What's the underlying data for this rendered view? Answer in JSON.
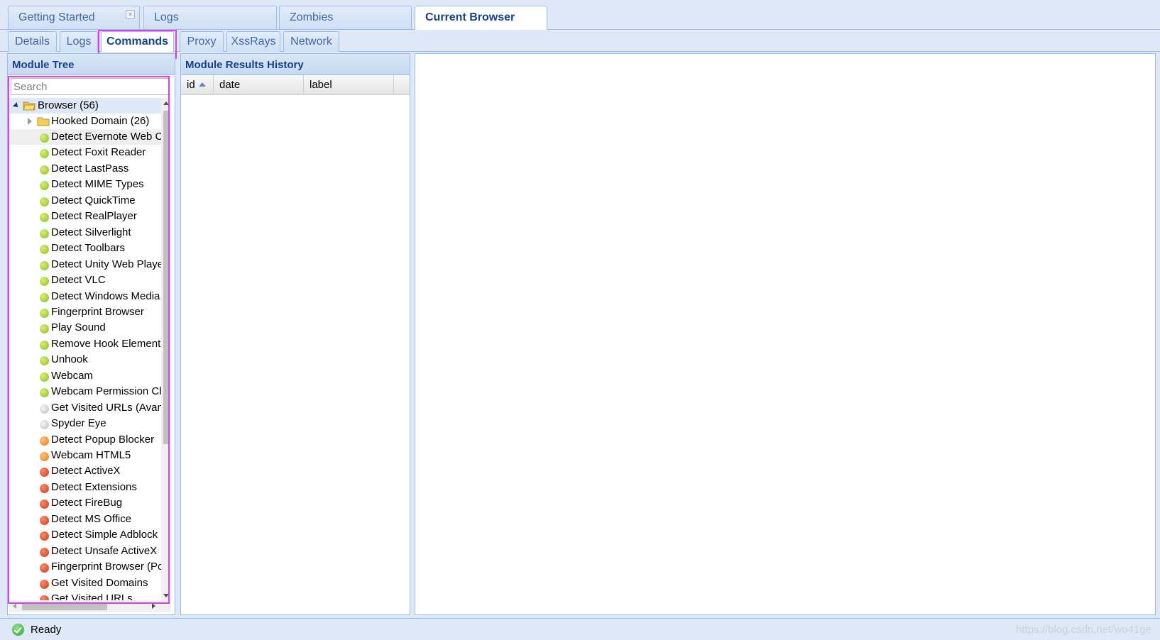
{
  "top_tabs": [
    {
      "label": "Getting Started",
      "closable": true,
      "active": false
    },
    {
      "label": "Logs",
      "active": false
    },
    {
      "label": "Zombies",
      "active": false
    },
    {
      "label": "Current Browser",
      "active": true
    }
  ],
  "sub_tabs": [
    {
      "label": "Details",
      "active": false
    },
    {
      "label": "Logs",
      "active": false
    },
    {
      "label": "Commands",
      "active": true
    },
    {
      "label": "Proxy",
      "active": false
    },
    {
      "label": "XssRays",
      "active": false
    },
    {
      "label": "Network",
      "active": false
    }
  ],
  "close_glyph": "×",
  "module_tree": {
    "title": "Module Tree",
    "search_placeholder": "Search",
    "root": "Browser (56)",
    "folder": "Hooked Domain (26)",
    "items": [
      {
        "label": "Detect Evernote Web Clipper",
        "status": "green"
      },
      {
        "label": "Detect Foxit Reader",
        "status": "green"
      },
      {
        "label": "Detect LastPass",
        "status": "green"
      },
      {
        "label": "Detect MIME Types",
        "status": "green"
      },
      {
        "label": "Detect QuickTime",
        "status": "green"
      },
      {
        "label": "Detect RealPlayer",
        "status": "green"
      },
      {
        "label": "Detect Silverlight",
        "status": "green"
      },
      {
        "label": "Detect Toolbars",
        "status": "green"
      },
      {
        "label": "Detect Unity Web Player",
        "status": "green"
      },
      {
        "label": "Detect VLC",
        "status": "green"
      },
      {
        "label": "Detect Windows Media Player",
        "status": "green"
      },
      {
        "label": "Fingerprint Browser",
        "status": "green"
      },
      {
        "label": "Play Sound",
        "status": "green"
      },
      {
        "label": "Remove Hook Element",
        "status": "green"
      },
      {
        "label": "Unhook",
        "status": "green"
      },
      {
        "label": "Webcam",
        "status": "green"
      },
      {
        "label": "Webcam Permission Check",
        "status": "green"
      },
      {
        "label": "Get Visited URLs (Avant Browser)",
        "status": "grey"
      },
      {
        "label": "Spyder Eye",
        "status": "grey"
      },
      {
        "label": "Detect Popup Blocker",
        "status": "orange"
      },
      {
        "label": "Webcam HTML5",
        "status": "orange"
      },
      {
        "label": "Detect ActiveX",
        "status": "red"
      },
      {
        "label": "Detect Extensions",
        "status": "red"
      },
      {
        "label": "Detect FireBug",
        "status": "red"
      },
      {
        "label": "Detect MS Office",
        "status": "red"
      },
      {
        "label": "Detect Simple Adblock",
        "status": "red"
      },
      {
        "label": "Detect Unsafe ActiveX",
        "status": "red"
      },
      {
        "label": "Fingerprint Browser (PoC)",
        "status": "red"
      },
      {
        "label": "Get Visited Domains",
        "status": "red"
      },
      {
        "label": "Get Visited URLs",
        "status": "red"
      }
    ]
  },
  "results_history": {
    "title": "Module Results History",
    "columns": [
      "id",
      "date",
      "label"
    ],
    "sort": {
      "column": "id",
      "direction": "ascending"
    },
    "rows": []
  },
  "status_bar": {
    "text": "Ready",
    "watermark": "https://blog.csdn.net/wo41ge"
  }
}
